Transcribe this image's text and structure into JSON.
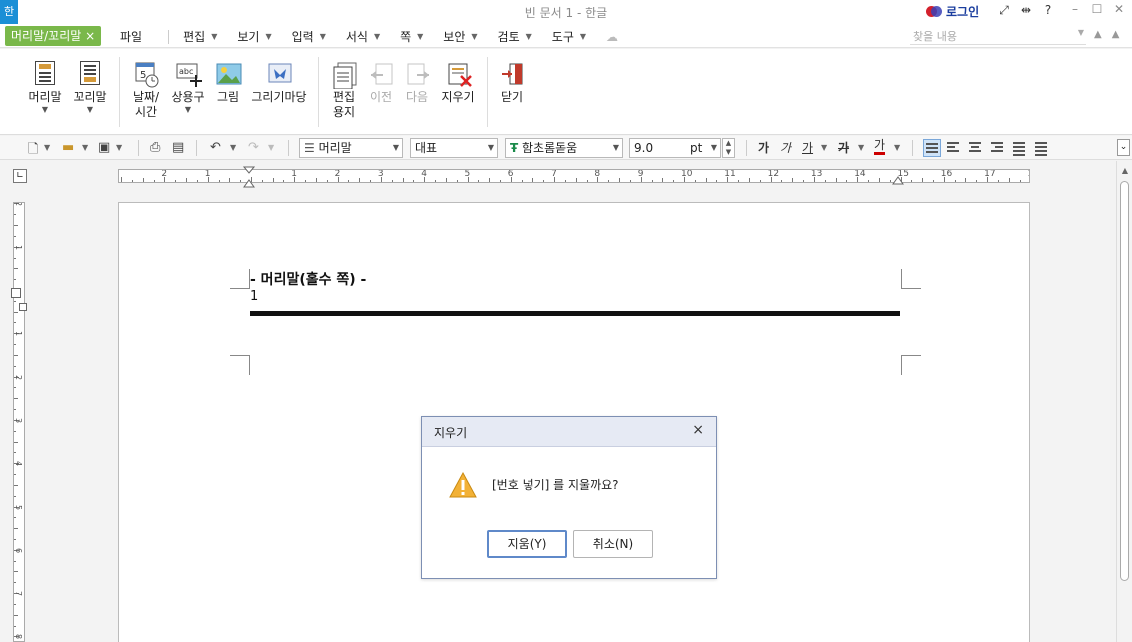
{
  "titlebar": {
    "app_logo": "한",
    "doc_title": "빈 문서 1 - 한글",
    "login_label": "로그인",
    "icons": [
      "fullscreen-icon",
      "split-view-icon",
      "help-icon"
    ],
    "help_label": "?",
    "window": [
      "minimize-icon",
      "maximize-icon",
      "close-icon"
    ]
  },
  "menubar": {
    "context_tab": "머리말/꼬리말",
    "context_tab_close": "×",
    "items": [
      {
        "label": "파일"
      },
      {
        "label": "편집"
      },
      {
        "label": "보기"
      },
      {
        "label": "입력"
      },
      {
        "label": "서식"
      },
      {
        "label": "쪽"
      },
      {
        "label": "보안"
      },
      {
        "label": "검토"
      },
      {
        "label": "도구"
      }
    ],
    "search_placeholder": "찾을 내용"
  },
  "ribbon": {
    "buttons": [
      {
        "label": "머리말",
        "icon": "header-icon"
      },
      {
        "label": "꼬리말",
        "icon": "footer-icon"
      },
      {
        "label": "날짜/",
        "label2": "시간",
        "icon": "date-time-icon"
      },
      {
        "label": "상용구",
        "icon": "autotext-icon"
      },
      {
        "label": "그림",
        "icon": "picture-icon"
      },
      {
        "label": "그리기마당",
        "icon": "drawing-gallery-icon"
      },
      {
        "label": "편집",
        "label2": "용지",
        "icon": "edit-paper-icon"
      },
      {
        "label": "이전",
        "icon": "previous-icon"
      },
      {
        "label": "다음",
        "icon": "next-icon"
      },
      {
        "label": "지우기",
        "icon": "erase-icon"
      },
      {
        "label": "닫기",
        "icon": "close-header-icon"
      }
    ]
  },
  "format": {
    "style": "머리말",
    "lang": "대표",
    "font": "함초롬돋움",
    "size": "9.0",
    "unit": "pt",
    "bold_glyph": "가",
    "italic_glyph": "가",
    "underline_glyph": "가",
    "strike_glyph": "가",
    "color_glyph": "가",
    "font_color": "#cc0000"
  },
  "ruler": {
    "labels_left": [
      "2",
      "1"
    ],
    "labels_right": [
      "1",
      "2",
      "3",
      "4",
      "5",
      "6",
      "7",
      "8",
      "9",
      "10",
      "11",
      "12",
      "13",
      "14",
      "15",
      "16",
      "17",
      "18"
    ],
    "vlabels": [
      "2",
      "1",
      "1",
      "2",
      "3",
      "4",
      "5",
      "6",
      "7",
      "8"
    ]
  },
  "document": {
    "header_title": "- 머리말(홀수 쪽) -",
    "page_number": "1"
  },
  "dialog": {
    "title": "지우기",
    "message": "[번호 넣기] 를 지울까요?",
    "yes_label": "지움(Y)",
    "cancel_label": "취소(N)",
    "close_label": "×"
  },
  "colors": {
    "context_tab": "#7ab84a",
    "accent": "#1b8fd6",
    "warning": "#f2b136"
  }
}
